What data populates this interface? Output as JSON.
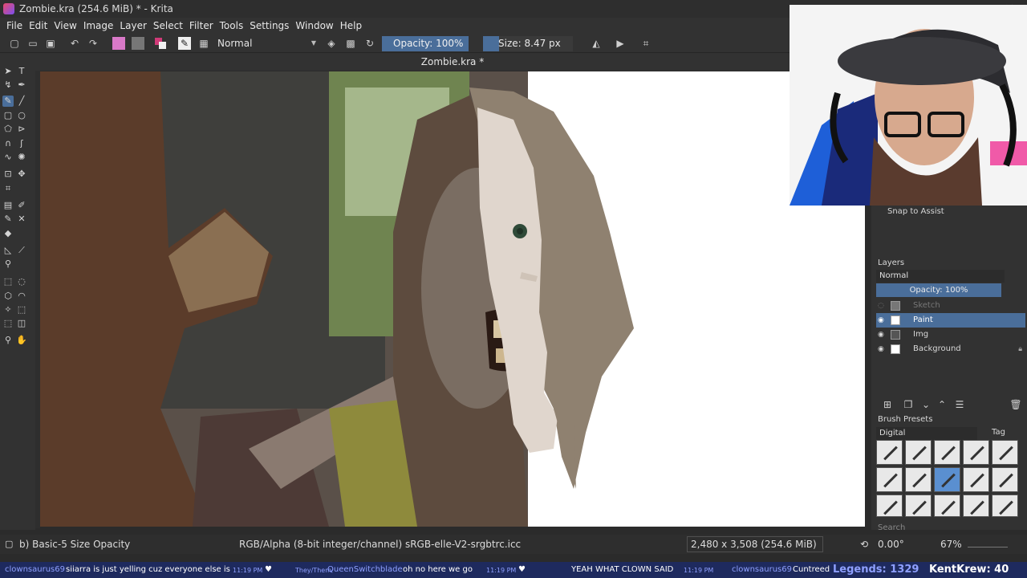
{
  "window": {
    "title": "Zombie.kra (254.6 MiB)  * - Krita"
  },
  "menu": [
    "File",
    "Edit",
    "View",
    "Image",
    "Layer",
    "Select",
    "Filter",
    "Tools",
    "Settings",
    "Window",
    "Help"
  ],
  "tool_options": {
    "blend_mode": "Normal",
    "opacity_label": "Opacity: 100%",
    "size_label": "Size: 8.47 px"
  },
  "document": {
    "tab_title": "Zombie.kra *"
  },
  "dock": {
    "snap_label": "Snap to Assist",
    "layers": {
      "title": "Layers",
      "blend_mode": "Normal",
      "opacity_label": "Opacity:  100%",
      "items": [
        {
          "name": "Sketch",
          "state": "hidden"
        },
        {
          "name": "Paint",
          "state": "selected"
        },
        {
          "name": "Img",
          "state": "visible"
        },
        {
          "name": "Background",
          "state": "locked"
        }
      ]
    },
    "brush_presets": {
      "title": "Brush Presets",
      "tag": "Digital",
      "tag_button": "Tag",
      "search_placeholder": "Search"
    }
  },
  "status": {
    "brush": "b) Basic-5 Size Opacity",
    "color_profile": "RGB/Alpha (8-bit integer/channel)  sRGB-elle-V2-srgbtrc.icc",
    "image_size": "2,480 x 3,508 (254.6 MiB)",
    "rotation": "0.00°",
    "zoom": "67%"
  },
  "ticker": {
    "msg1_user": "clownsaurus69",
    "msg1_text": "siiarra is just yelling cuz everyone else is",
    "time1": "11:19 PM",
    "pronoun": "They/Them",
    "msg2_user": "QueenSwitchblade",
    "msg2_text": "oh no here we go",
    "time2": "11:19 PM",
    "msg3_text": "YEAH WHAT CLOWN SAID",
    "time3": "11:19 PM",
    "msg4_user": "clownsaurus69",
    "msg4_text": "Cuntreed",
    "legends": "Legends: 1329",
    "kentkrew": "KentKrew: 40"
  },
  "colors": {
    "accent": "#4a6e9a",
    "panel": "#323232",
    "ticker_bg": "#1e2a5e"
  }
}
